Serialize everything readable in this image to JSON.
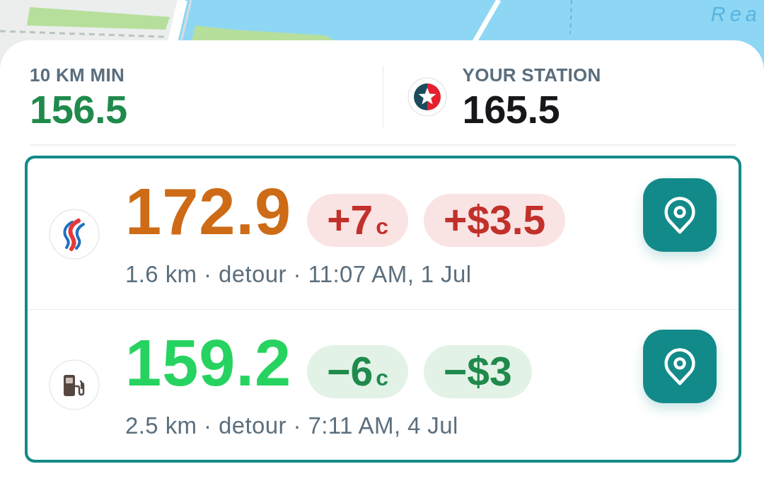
{
  "map": {
    "label": "Rea"
  },
  "summary": {
    "nearby_minimum": {
      "label": "10 KM MIN",
      "price": "156.5"
    },
    "your_station": {
      "label": "YOUR STATION",
      "price": "165.5"
    }
  },
  "stations": [
    {
      "kind": "higher",
      "logo": {
        "kind": "brand"
      },
      "price": "172.9",
      "cents_difference": {
        "value": "+7",
        "unit": "c"
      },
      "cost_difference": "+$3.5",
      "details": "1.6 km · detour · 11:07 AM, 1 Jul"
    },
    {
      "kind": "lower",
      "logo": {
        "kind": "generic"
      },
      "price": "159.2",
      "cents_difference": {
        "value": "−6",
        "unit": "c"
      },
      "cost_difference": "−$3",
      "details": "2.5 km · detour · 7:11 AM, 4 Jul"
    }
  ]
}
